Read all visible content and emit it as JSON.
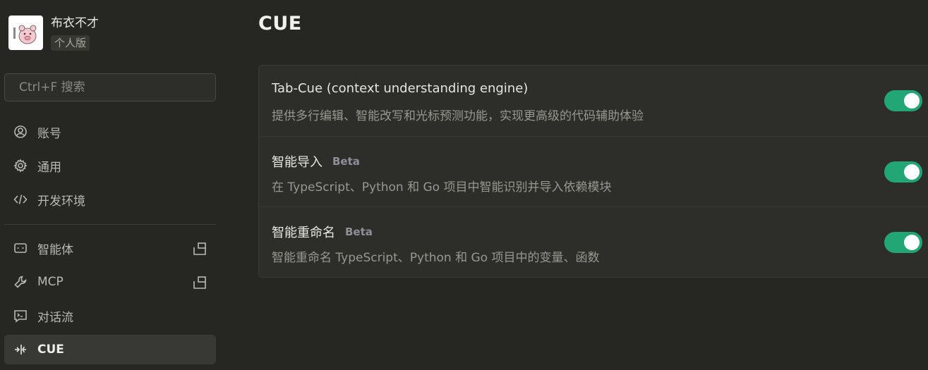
{
  "profile": {
    "name": "布衣不才",
    "plan": "个人版"
  },
  "search": {
    "placeholder": "Ctrl+F 搜索"
  },
  "nav": {
    "group1": [
      {
        "label": "账号",
        "icon": "user-circle-icon"
      },
      {
        "label": "通用",
        "icon": "gear-icon"
      },
      {
        "label": "开发环境",
        "icon": "code-icon"
      }
    ],
    "group2": [
      {
        "label": "智能体",
        "icon": "robot-icon",
        "external": true
      },
      {
        "label": "MCP",
        "icon": "wrench-icon",
        "external": true
      },
      {
        "label": "对话流",
        "icon": "terminal-icon",
        "external": false
      },
      {
        "label": "CUE",
        "icon": "cue-icon",
        "external": false,
        "active": true
      }
    ]
  },
  "page": {
    "title": "CUE"
  },
  "settings": [
    {
      "title": "Tab-Cue (context understanding engine)",
      "badge": "",
      "description": "提供多行编辑、智能改写和光标预测功能，实现更高级的代码辅助体验",
      "enabled": true
    },
    {
      "title": "智能导入",
      "badge": "Beta",
      "description": "在 TypeScript、Python 和 Go 项目中智能识别并导入依赖模块",
      "enabled": true
    },
    {
      "title": "智能重命名",
      "badge": "Beta",
      "description": "智能重命名 TypeScript、Python 和 Go 项目中的变量、函数",
      "enabled": true
    }
  ],
  "colors": {
    "toggle_on": "#23a675",
    "background": "#262622",
    "card": "#2d2d29"
  }
}
